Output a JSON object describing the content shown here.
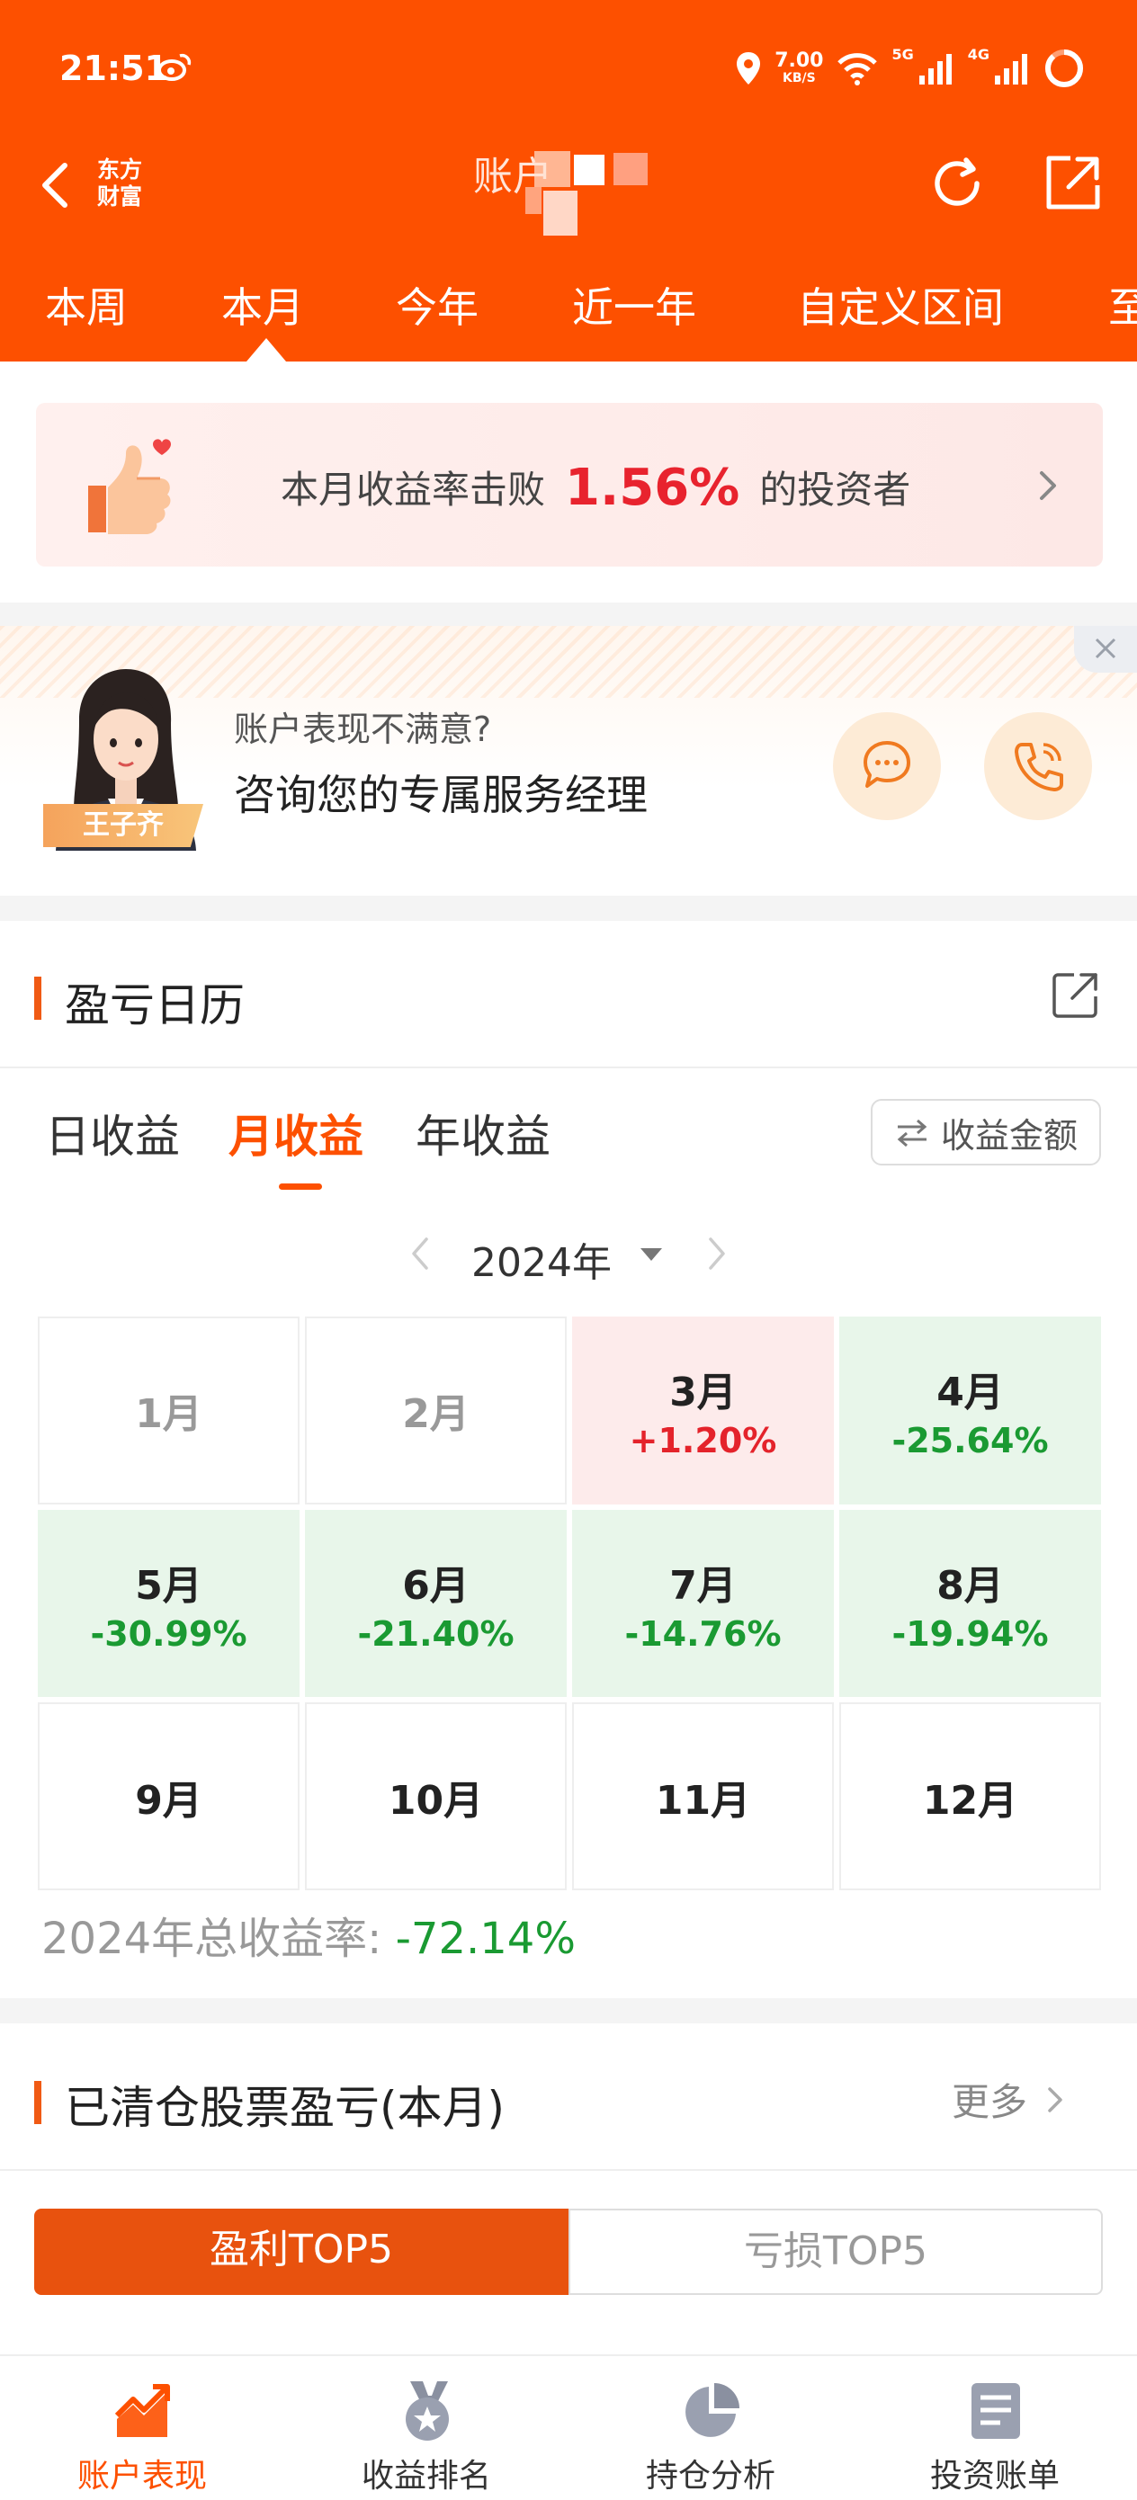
{
  "status_bar": {
    "time": "21:51",
    "net_speed_value": "7.00",
    "net_speed_unit": "KB/S",
    "sim1": "5G",
    "sim2": "4G"
  },
  "top_nav": {
    "logo_line1": "东方",
    "logo_line2": "财富",
    "title": "账户"
  },
  "period_tabs": [
    "本周",
    "本月",
    "今年",
    "近一年",
    "自定义区间",
    "至"
  ],
  "active_period": "本月",
  "beat_banner": {
    "prefix": "本月收益率击败",
    "rate": "1.56%",
    "suffix": "的投资者"
  },
  "service": {
    "manager_name": "王子齐",
    "subtitle": "账户表现不满意?",
    "title": "咨询您的专属服务经理"
  },
  "pnl_calendar": {
    "title": "盈亏日历",
    "modes": [
      "日收益",
      "月收益",
      "年收益"
    ],
    "active_mode": "月收益",
    "amount_toggle": "收益金额",
    "year": "2024年",
    "months": [
      {
        "label": "1月",
        "rate": "",
        "state": "empty"
      },
      {
        "label": "2月",
        "rate": "",
        "state": "empty"
      },
      {
        "label": "3月",
        "rate": "+1.20%",
        "state": "up"
      },
      {
        "label": "4月",
        "rate": "-25.64%",
        "state": "down"
      },
      {
        "label": "5月",
        "rate": "-30.99%",
        "state": "down"
      },
      {
        "label": "6月",
        "rate": "-21.40%",
        "state": "down"
      },
      {
        "label": "7月",
        "rate": "-14.76%",
        "state": "down"
      },
      {
        "label": "8月",
        "rate": "-19.94%",
        "state": "down"
      },
      {
        "label": "9月",
        "rate": "",
        "state": "future"
      },
      {
        "label": "10月",
        "rate": "",
        "state": "future"
      },
      {
        "label": "11月",
        "rate": "",
        "state": "future"
      },
      {
        "label": "12月",
        "rate": "",
        "state": "future"
      }
    ],
    "total_label": "2024年总收益率:",
    "total_value": "-72.14%"
  },
  "cleared_stocks": {
    "title": "已清仓股票盈亏(本月)",
    "more": "更多",
    "segments": [
      "盈利TOP5",
      "亏损TOP5"
    ],
    "active_segment": "盈利TOP5"
  },
  "bottom_nav": [
    {
      "label": "账户表现",
      "icon": "trend-chart-icon",
      "active": true
    },
    {
      "label": "收益排名",
      "icon": "medal-icon",
      "active": false
    },
    {
      "label": "持仓分析",
      "icon": "pie-chart-icon",
      "active": false
    },
    {
      "label": "投资账单",
      "icon": "document-icon",
      "active": false
    }
  ],
  "colors": {
    "brand_orange": "#fd5000",
    "up_red": "#e4232b",
    "down_green": "#1a9a32"
  }
}
